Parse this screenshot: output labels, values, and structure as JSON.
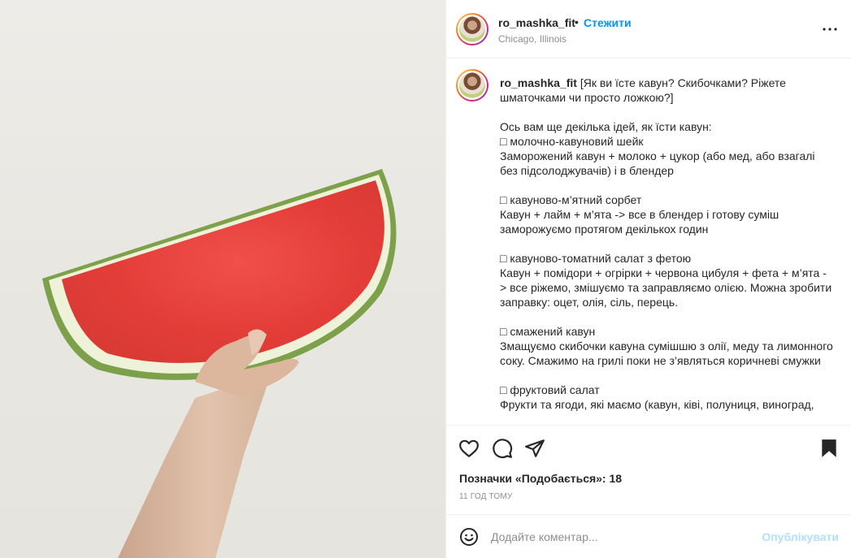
{
  "post": {
    "photo_alt": "watermelon-slice-photo"
  },
  "header": {
    "username": "ro_mashka_fit",
    "dot": "•",
    "follow_label": "Стежити",
    "location": "Chicago, Illinois"
  },
  "caption": {
    "username": "ro_mashka_fit",
    "text": " [Як ви їсте кавун? Скибочками? Ріжете шматочками чи просто ложкою?]\n\nОсь вам ще декілька ідей, як їсти кавун:\n□ молочно-кавуновий шейк\nЗаморожений кавун + молоко + цукор (або мед, або взагалі без підсолоджувачів) і в блендер\n\n□ кавуново-м’ятний сорбет\nКавун + лайм + м’ята -> все в блендер і готову суміш заморожуємо протягом декількох годин\n\n□ кавуново-томатний салат з фетою\nКавун + помідори + огрірки + червона цибуля + фета + м’ята -> все ріжемо, змішуємо та заправляємо олією. Можна зробити заправку: оцет, олія, сіль, перець.\n\n□ смажений кавун\nЗмащуємо скибочки кавуна сумішшю з олії, меду та лимонного соку. Смажимо на грилі поки не з’являться коричневі смужки\n\n□ фруктовий салат\nФрукти та ягоди, які маємо (кавун, ківі, полуниця, виноград,"
  },
  "actions": {
    "like_icon": "heart-icon",
    "comment_icon": "comment-icon",
    "share_icon": "paper-plane-icon",
    "save_icon": "bookmark-icon",
    "likes_text": "Позначки «Подобається»: 18",
    "time_ago": "11 ГОД ТОМУ"
  },
  "add_comment": {
    "emoji_icon": "smiley-icon",
    "placeholder": "Додайте коментар...",
    "post_label": "Опублікувати",
    "post_color": "#b2dffc"
  },
  "colors": {
    "accent": "#0095f6",
    "secondary_text": "#8e8e8e",
    "text": "#262626"
  }
}
